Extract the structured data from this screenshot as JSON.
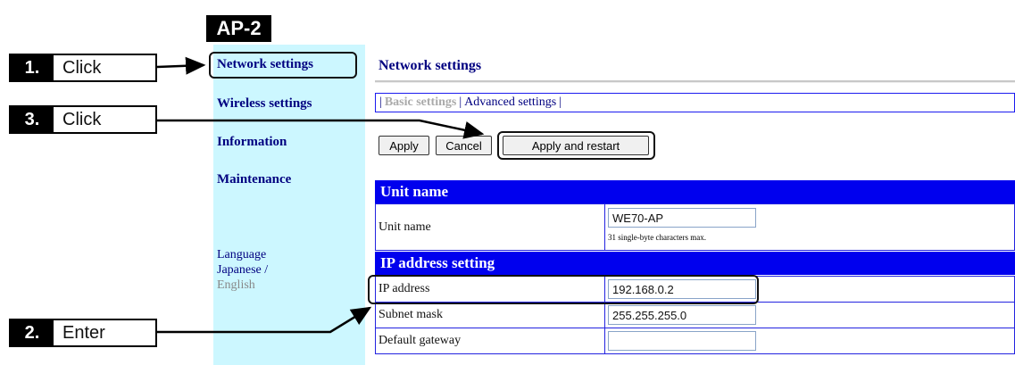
{
  "badge": "AP-2",
  "steps": [
    {
      "num": "1.",
      "text": "Click"
    },
    {
      "num": "3.",
      "text": "Click"
    },
    {
      "num": "2.",
      "text": "Enter"
    }
  ],
  "sidebar": {
    "items": [
      "Network settings",
      "Wireless settings",
      "Information",
      "Maintenance"
    ],
    "language_label": "Language",
    "japanese": "Japanese",
    "slash": "/",
    "english": "English"
  },
  "main": {
    "title": "Network settings",
    "tabs": {
      "sep": "|",
      "basic": "Basic settings",
      "advanced": "Advanced settings"
    },
    "buttons": {
      "apply": "Apply",
      "cancel": "Cancel",
      "apply_restart": "Apply and restart"
    },
    "unit_section": {
      "heading": "Unit name",
      "label": "Unit name",
      "value": "WE70-AP",
      "hint": "31 single-byte characters max."
    },
    "ip_section": {
      "heading": "IP address setting",
      "rows": [
        {
          "label": "IP address",
          "value": "192.168.0.2"
        },
        {
          "label": "Subnet mask",
          "value": "255.255.255.0"
        },
        {
          "label": "Default gateway",
          "value": ""
        }
      ]
    }
  }
}
